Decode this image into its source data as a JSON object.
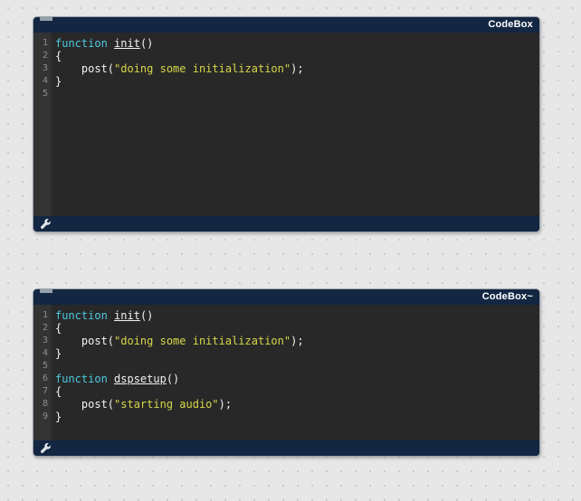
{
  "canvas": {
    "background_color": "#e7e7e7",
    "dot_color": "#c9c9c9"
  },
  "theme": {
    "titlebar_color": "#132642",
    "code_background": "#282828",
    "gutter_background": "#333333",
    "keyword_color": "#4ec9e0",
    "string_color": "#d7d74b",
    "plain_text_color": "#f2f2f2",
    "line_number_color": "#8f8f8f"
  },
  "windows": [
    {
      "title": "CodeBox",
      "footer_icon": "wrench-icon",
      "line_numbers": [
        "1",
        "2",
        "3",
        "4",
        "5"
      ],
      "lines": [
        [
          {
            "text": "function ",
            "type": "keyword"
          },
          {
            "text": "init",
            "type": "function-name"
          },
          {
            "text": "()",
            "type": "plain"
          }
        ],
        [
          {
            "text": "{",
            "type": "plain"
          }
        ],
        [
          {
            "text": "    post(",
            "type": "plain"
          },
          {
            "text": "\"doing some initialization\"",
            "type": "string"
          },
          {
            "text": ");",
            "type": "plain"
          }
        ],
        [
          {
            "text": "}",
            "type": "plain"
          }
        ],
        []
      ]
    },
    {
      "title": "CodeBox~",
      "footer_icon": "wrench-icon",
      "line_numbers": [
        "1",
        "2",
        "3",
        "4",
        "5",
        "6",
        "7",
        "8",
        "9"
      ],
      "lines": [
        [
          {
            "text": "function ",
            "type": "keyword"
          },
          {
            "text": "init",
            "type": "function-name"
          },
          {
            "text": "()",
            "type": "plain"
          }
        ],
        [
          {
            "text": "{",
            "type": "plain"
          }
        ],
        [
          {
            "text": "    post(",
            "type": "plain"
          },
          {
            "text": "\"doing some initialization\"",
            "type": "string"
          },
          {
            "text": ");",
            "type": "plain"
          }
        ],
        [
          {
            "text": "}",
            "type": "plain"
          }
        ],
        [],
        [
          {
            "text": "function ",
            "type": "keyword"
          },
          {
            "text": "dspsetup",
            "type": "function-name"
          },
          {
            "text": "()",
            "type": "plain"
          }
        ],
        [
          {
            "text": "{",
            "type": "plain"
          }
        ],
        [
          {
            "text": "    post(",
            "type": "plain"
          },
          {
            "text": "\"starting audio\"",
            "type": "string"
          },
          {
            "text": ");",
            "type": "plain"
          }
        ],
        [
          {
            "text": "}",
            "type": "plain"
          }
        ]
      ]
    }
  ]
}
